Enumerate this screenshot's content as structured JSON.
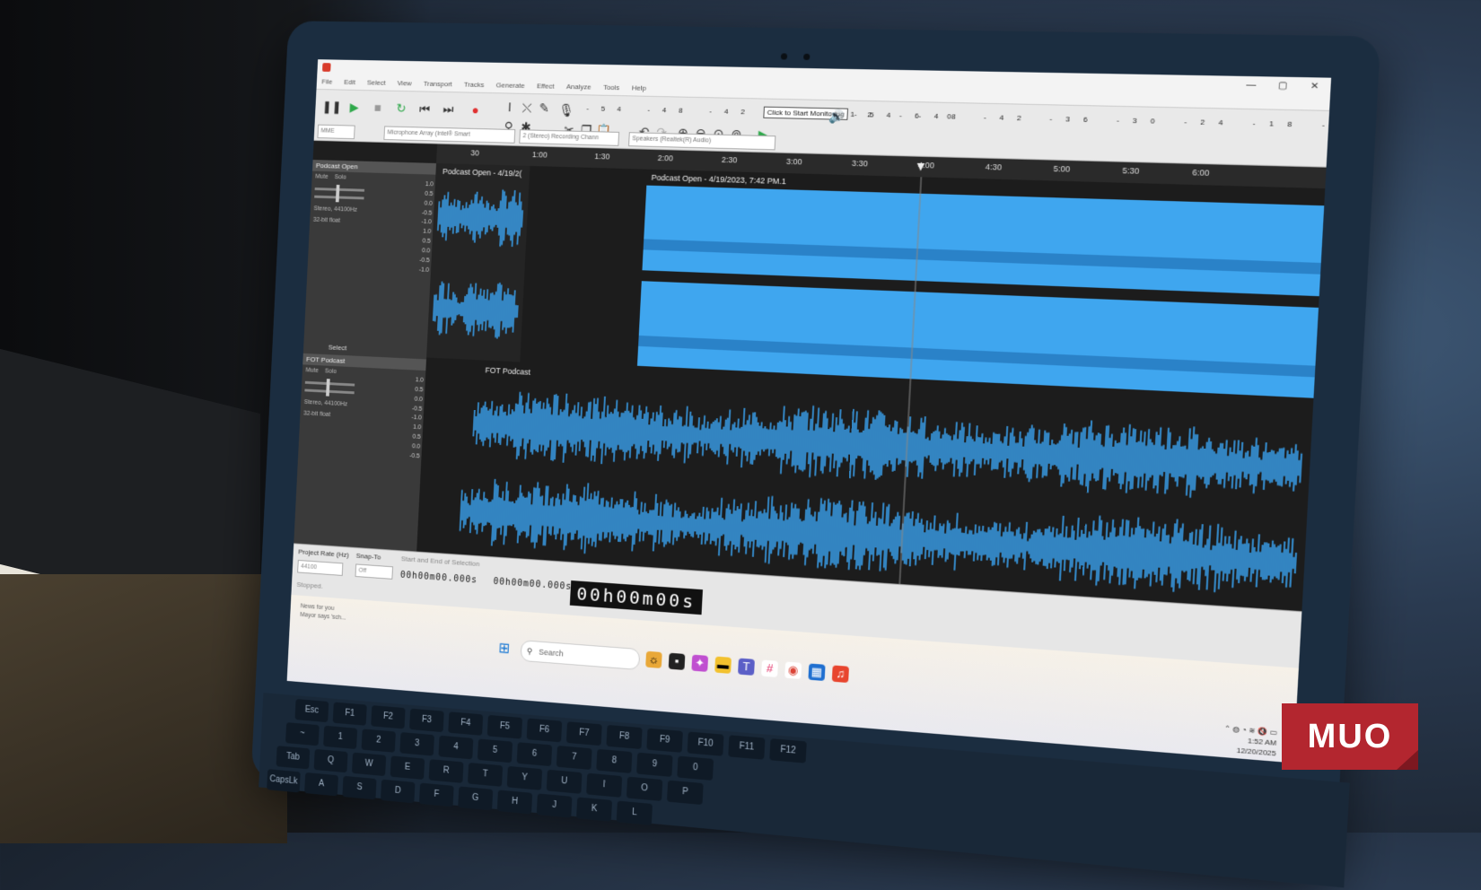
{
  "window": {
    "menu": [
      "File",
      "Edit",
      "Select",
      "View",
      "Transport",
      "Tracks",
      "Generate",
      "Effect",
      "Analyze",
      "Tools",
      "Help"
    ]
  },
  "toolbar": {
    "monitor_label": "Click to Start Monitoring",
    "rec_meter_scale": "-54 -48 -42 -18 -12 -6 0",
    "play_meter_scale": "-54 -48 -42 -36 -30 -24 -18 -12 -6 0",
    "host": "MME",
    "recording_device": "Microphone Array (Intel® Smart",
    "recording_channels": "2 (Stereo) Recording Chann",
    "playback_device": "Speakers (Realtek(R) Audio)"
  },
  "ruler": {
    "ticks": [
      "30",
      "1:00",
      "1:30",
      "2:00",
      "2:30",
      "3:00",
      "3:30",
      "4:00",
      "4:30",
      "5:00",
      "5:30",
      "6:00"
    ]
  },
  "tracks": [
    {
      "name": "Podcast Open",
      "mute": "Mute",
      "solo": "Solo",
      "info": "Stereo, 44100Hz",
      "info2": "32-bit float",
      "select_label": "Select",
      "clips": [
        "Podcast Open - 4/19/2(",
        "Podcast Open - 4/19/2023, 7:42 PM.1"
      ],
      "scale": [
        "1.0",
        "0.5",
        "0.0",
        "-0.5",
        "-1.0",
        "1.0",
        "0.5",
        "0.0",
        "-0.5",
        "-1.0"
      ]
    },
    {
      "name": "FOT Podcast",
      "mute": "Mute",
      "solo": "Solo",
      "info": "Stereo, 44100Hz",
      "info2": "32-bit float",
      "clips": [
        "FOT Podcast"
      ],
      "scale": [
        "1.0",
        "0.5",
        "0.0",
        "-0.5",
        "-1.0",
        "1.0",
        "0.5",
        "0.0",
        "-0.5"
      ]
    }
  ],
  "selection_bar": {
    "project_rate_label": "Project Rate (Hz)",
    "project_rate_value": "44100",
    "snap_to_label": "Snap-To",
    "snap_to_value": "Off",
    "selection_label": "Start and End of Selection",
    "start_time": "00h00m00.000s",
    "end_time": "00h00m00.000s",
    "status": "Stopped.",
    "audio_position": "00h00m00s"
  },
  "taskbar": {
    "news_title": "News for you",
    "news_sub": "Mayor says 'sch...",
    "search_placeholder": "Search",
    "time": "1:52 AM",
    "date": "12/20/2025"
  },
  "keyboard": {
    "keys": [
      "Esc",
      "F1",
      "F2",
      "F3",
      "F4",
      "F5",
      "F6",
      "F7",
      "F8",
      "F9",
      "F10",
      "F11",
      "F12",
      "~",
      "1",
      "2",
      "3",
      "4",
      "5",
      "6",
      "7",
      "8",
      "9",
      "0",
      "Tab",
      "Q",
      "W",
      "E",
      "R",
      "T",
      "Y",
      "U",
      "I",
      "O",
      "P",
      "CapsLk",
      "A",
      "S",
      "D",
      "F",
      "G",
      "H",
      "J",
      "K",
      "L"
    ]
  },
  "watermark": {
    "text": "MUO",
    "color": "#b3262f"
  },
  "colors": {
    "waveform": "#3aa0ec",
    "clip_selected": "#3fa6ef",
    "track_bg": "#1c1c1c"
  }
}
